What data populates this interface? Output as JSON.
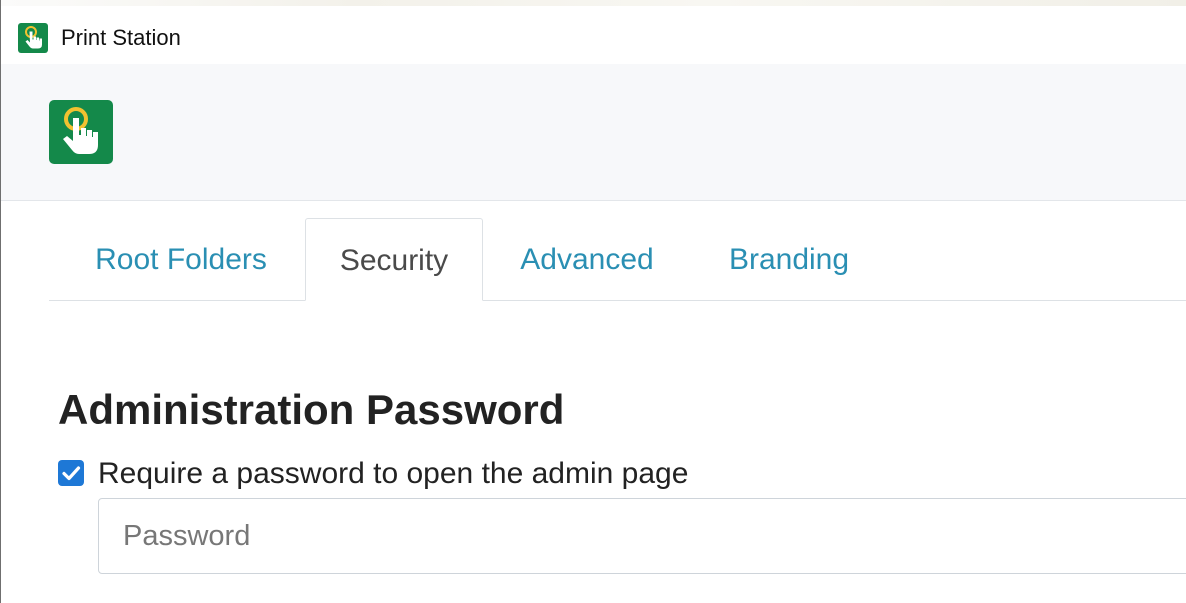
{
  "window": {
    "title": "Print Station",
    "icon": "touch-hand-icon"
  },
  "header": {
    "logo_icon": "touch-hand-icon"
  },
  "tabs": [
    {
      "label": "Root Folders",
      "active": false
    },
    {
      "label": "Security",
      "active": true
    },
    {
      "label": "Advanced",
      "active": false
    },
    {
      "label": "Branding",
      "active": false
    }
  ],
  "security": {
    "section_title": "Administration Password",
    "require_password": {
      "label": "Require a password to open the admin page",
      "checked": true
    },
    "password": {
      "placeholder": "Password",
      "value": ""
    }
  },
  "colors": {
    "brand_green": "#14894a",
    "tab_link": "#2a8fb3",
    "checkbox_blue": "#1e78d6",
    "header_bg": "#f7f8fa"
  }
}
